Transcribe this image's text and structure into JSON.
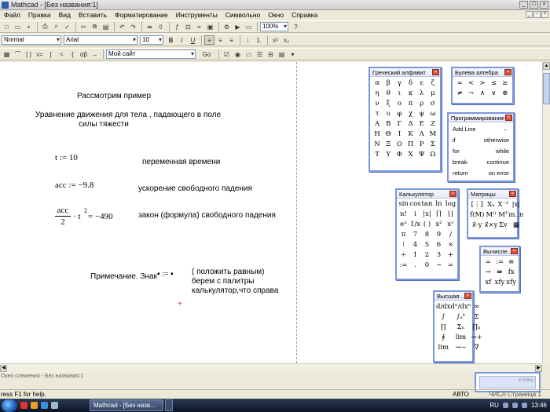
{
  "window": {
    "title": "Mathcad - [Без названия:1]"
  },
  "menu": [
    "Файл",
    "Правка",
    "Вид",
    "Вставить",
    "Форматирование",
    "Инструменты",
    "Символьно",
    "Окно",
    "Справка"
  ],
  "toolbar": {
    "style_combo": "Normal",
    "font_combo": "Arial",
    "size_combo": "10",
    "zoom_combo": "100%",
    "resource_combo": "Мой сайт",
    "go_label": "Go",
    "bold": "B",
    "italic": "I",
    "underline": "U"
  },
  "worksheet": {
    "heading": "Рассмотрим пример",
    "subtitle_line1": "Уравнение движения для тела , падающего в поле",
    "subtitle_line2": "силы  тяжести",
    "eq_t": "t := 10",
    "comment_t": "переменная времени",
    "eq_acc": "acc := −9.8",
    "comment_acc": "ускорение свободного падения",
    "eq_law_num": "acc",
    "eq_law_den": "2",
    "eq_law_rest": "· t",
    "eq_law_exp": "2",
    "eq_law_result": " = −490",
    "comment_law": "закон (формула) свободного падения",
    "note_label": "Примечание. Знак",
    "note_sign": "▪ := ▪",
    "note_line1": "( положить равным)",
    "note_line2": "берем с палитры",
    "note_line3": "калькулятор,что справа"
  },
  "palettes": {
    "greek": {
      "title": "Греческий алфавит",
      "symbols": [
        "α",
        "β",
        "γ",
        "δ",
        "ε",
        "ζ",
        "η",
        "θ",
        "ι",
        "κ",
        "λ",
        "μ",
        "ν",
        "ξ",
        "ο",
        "π",
        "ρ",
        "σ",
        "τ",
        "υ",
        "φ",
        "χ",
        "ψ",
        "ω",
        "Α",
        "Β",
        "Γ",
        "Δ",
        "Ε",
        "Ζ",
        "Η",
        "Θ",
        "Ι",
        "Κ",
        "Λ",
        "Μ",
        "Ν",
        "Ξ",
        "Ο",
        "Π",
        "Ρ",
        "Σ",
        "Τ",
        "Υ",
        "Φ",
        "Χ",
        "Ψ",
        "Ω"
      ]
    },
    "boolean": {
      "title": "Булева алгебра",
      "symbols": [
        "=",
        "<",
        ">",
        "≤",
        "≥",
        "≠",
        "¬",
        "∧",
        "∨",
        "⊕"
      ]
    },
    "programming": {
      "title": "Программирование",
      "rows": [
        [
          "Add Line",
          "←"
        ],
        [
          "if",
          "otherwise"
        ],
        [
          "for",
          "while"
        ],
        [
          "break",
          "continue"
        ],
        [
          "return",
          "on error"
        ]
      ]
    },
    "calculator": {
      "title": "Калькулятор",
      "symbols": [
        "sin",
        "cos",
        "tan",
        "ln",
        "log",
        "n!",
        "i",
        "|x|",
        "⌈⌉",
        "⌊⌋",
        "eˣ",
        "1/x",
        "( )",
        "x²",
        "xʸ",
        "π",
        "7",
        "8",
        "9",
        "/",
        "⁞",
        "4",
        "5",
        "6",
        "×",
        "÷",
        "1",
        "2",
        "3",
        "+",
        ":=",
        ".",
        "0",
        "−",
        "="
      ]
    },
    "matrix": {
      "title": "Матрицы",
      "symbols": [
        "[⋮]",
        "Xₙ",
        "X⁻¹",
        "|x|",
        "f(M)",
        "M⁽⁾",
        "Mᵀ",
        "m..n",
        "x⃗·y",
        "x⃗×y",
        "Σv",
        "▦"
      ]
    },
    "evaluation": {
      "title": "Вычисле...",
      "symbols": [
        "=",
        ":=",
        "≡",
        "→",
        "⇛",
        "fx",
        "xf",
        "xfy",
        "xfy"
      ]
    },
    "calculus": {
      "title": "Высшая ...",
      "symbols": [
        "d/dx",
        "dⁿ/dxⁿ",
        "∞",
        "∫",
        "∫ₐᵇ",
        "Σ",
        "∏",
        "Σₙ",
        "∏ₙ",
        "∮",
        "lim",
        "→+",
        "lim",
        "→−",
        "∇"
      ]
    }
  },
  "status": {
    "trace_window": "Окно слежения - Без названия:1",
    "help": "ress F1 for help.",
    "mode": "АВТО",
    "num": "ЧИСЛ",
    "page": "Страница 1",
    "tray_lang": "RU",
    "clock": "13:46",
    "task": "Mathcad - [Без назв..."
  },
  "chip": {
    "label": "E.KB/ц"
  }
}
